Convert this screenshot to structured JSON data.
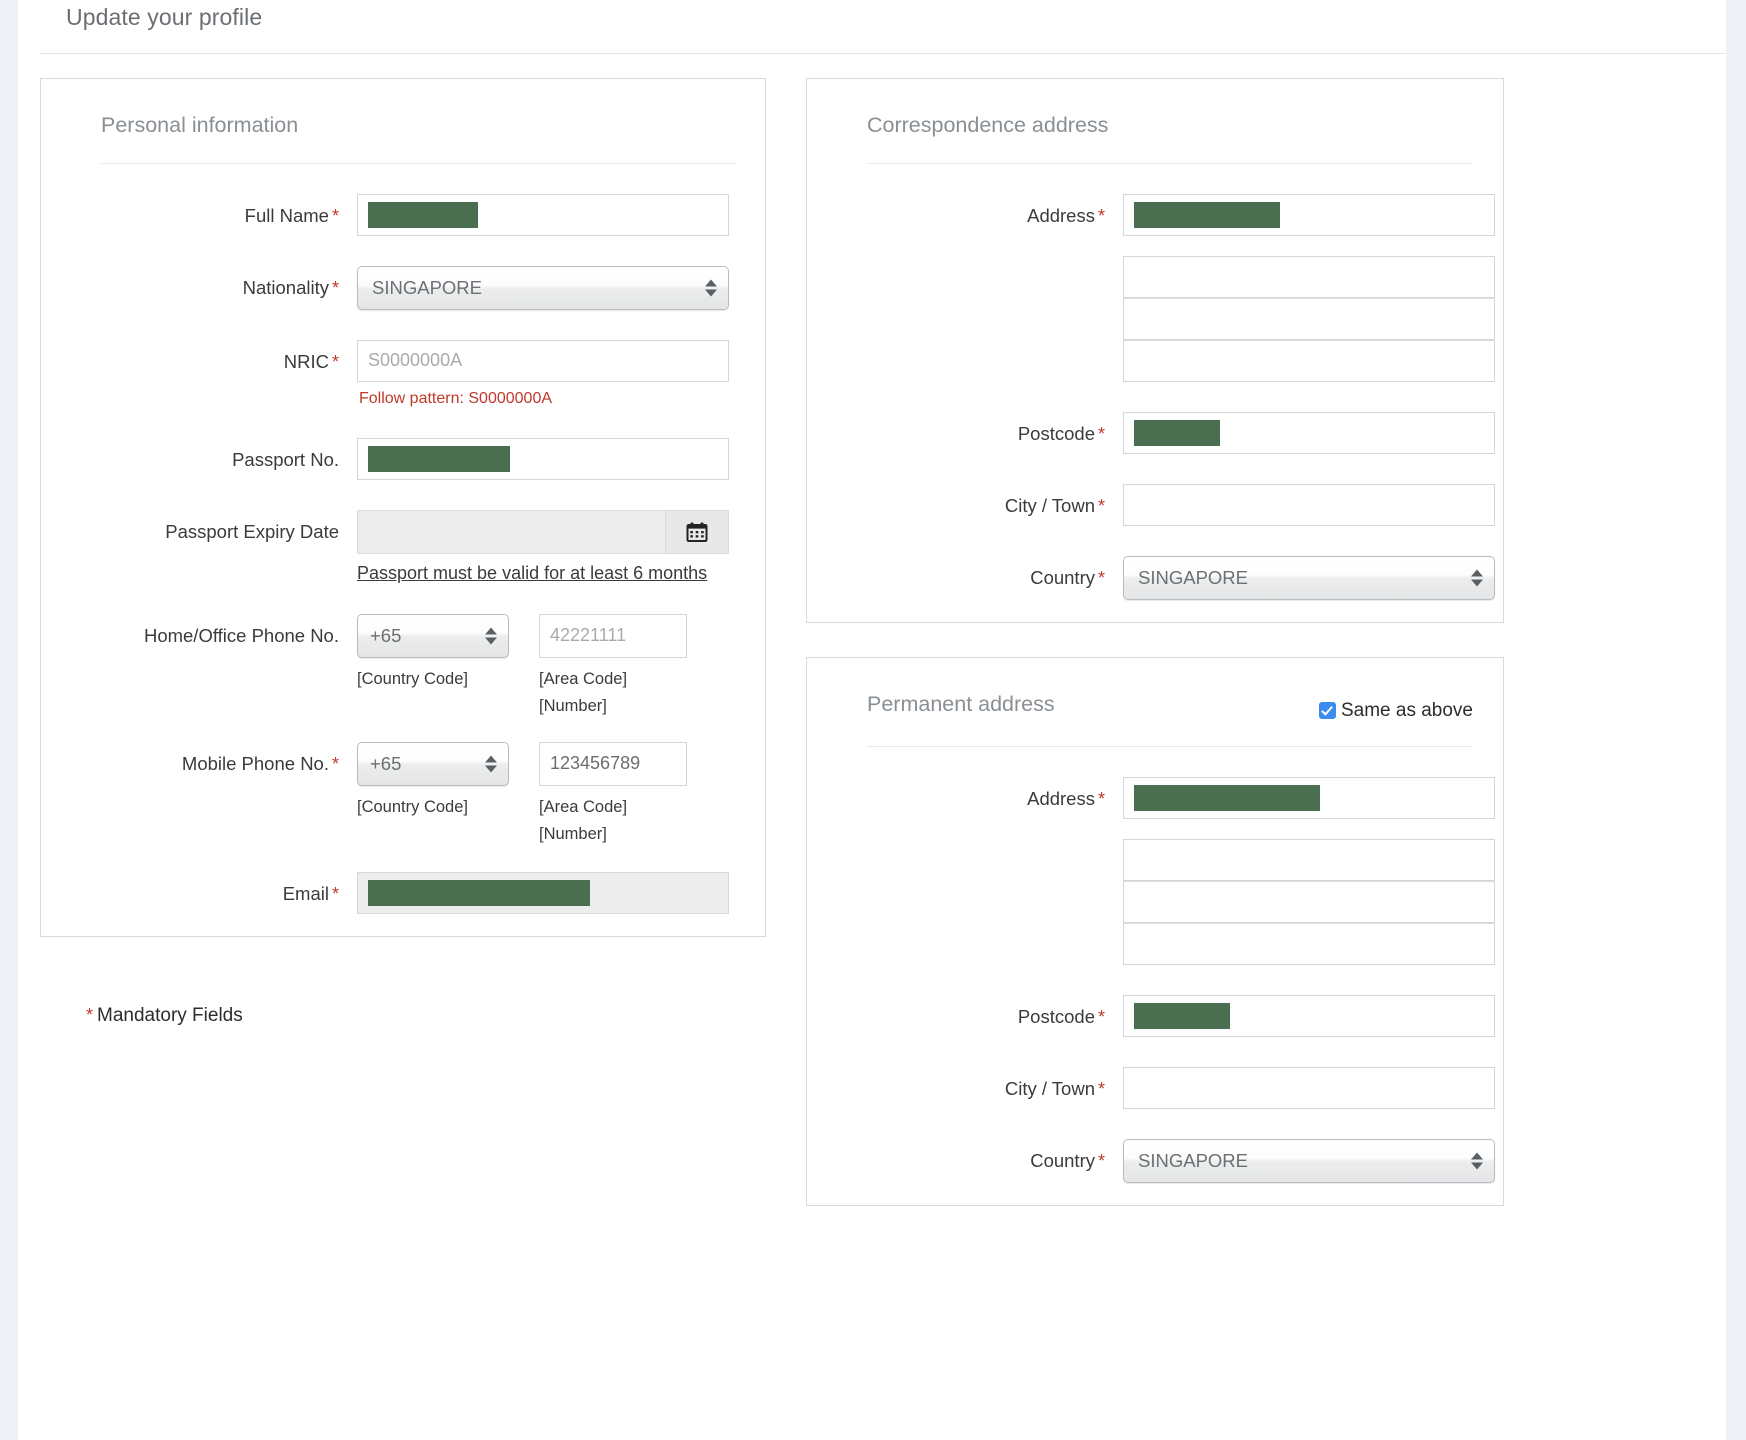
{
  "header": {
    "title": "Update your profile"
  },
  "colors": {
    "redaction_green": "#4a6f50",
    "required_asterisk": "#c0392b",
    "checkbox_blue": "#3b8bf0",
    "page_background": "#eef1f5"
  },
  "personal_information": {
    "title": "Personal information",
    "fields": {
      "full_name": {
        "label": "Full Name",
        "required_mark": "*",
        "value": "",
        "redacted": true
      },
      "nationality": {
        "label": "Nationality",
        "required_mark": "*",
        "value": "SINGAPORE"
      },
      "nric": {
        "label": "NRIC",
        "required_mark": "*",
        "placeholder": "S0000000A",
        "error": "Follow pattern: S0000000A"
      },
      "passport_no": {
        "label": "Passport No.",
        "required_mark": "",
        "value": "",
        "redacted": true
      },
      "passport_expiry": {
        "label": "Passport Expiry Date",
        "required_mark": "",
        "value": "",
        "hint": "Passport must be valid for at least 6 months",
        "icon": "calendar-icon"
      },
      "home_phone": {
        "label": "Home/Office Phone No.",
        "required_mark": "",
        "country_code": "+65",
        "number_placeholder": "42221111",
        "country_code_caption": "[Country Code]",
        "number_caption_line1": "[Area Code]",
        "number_caption_line2": "[Number]"
      },
      "mobile_phone": {
        "label": "Mobile Phone No.",
        "required_mark": "*",
        "country_code": "+65",
        "number_value": "123456789",
        "country_code_caption": "[Country Code]",
        "number_caption_line1": "[Area Code]",
        "number_caption_line2": "[Number]"
      },
      "email": {
        "label": "Email",
        "required_mark": "*",
        "value": "",
        "redacted": true
      }
    }
  },
  "mandatory_note": {
    "asterisk": "*",
    "text": "Mandatory Fields"
  },
  "correspondence_address": {
    "title": "Correspondence address",
    "fields": {
      "address": {
        "label": "Address",
        "required_mark": "*",
        "line1": "",
        "line1_redacted": true,
        "line2": "",
        "line3": "",
        "line4": ""
      },
      "postcode": {
        "label": "Postcode",
        "required_mark": "*",
        "value": "",
        "redacted": true
      },
      "city_town": {
        "label": "City / Town",
        "required_mark": "*",
        "value": ""
      },
      "country": {
        "label": "Country",
        "required_mark": "*",
        "value": "SINGAPORE"
      }
    }
  },
  "permanent_address": {
    "title": "Permanent address",
    "same_as_above_label": "Same as above",
    "same_as_above_checked": true,
    "fields": {
      "address": {
        "label": "Address",
        "required_mark": "*",
        "line1": "",
        "line1_redacted": true,
        "line2": "",
        "line3": "",
        "line4": ""
      },
      "postcode": {
        "label": "Postcode",
        "required_mark": "*",
        "value": "",
        "redacted": true
      },
      "city_town": {
        "label": "City / Town",
        "required_mark": "*",
        "value": ""
      },
      "country": {
        "label": "Country",
        "required_mark": "*",
        "value": "SINGAPORE"
      }
    }
  }
}
